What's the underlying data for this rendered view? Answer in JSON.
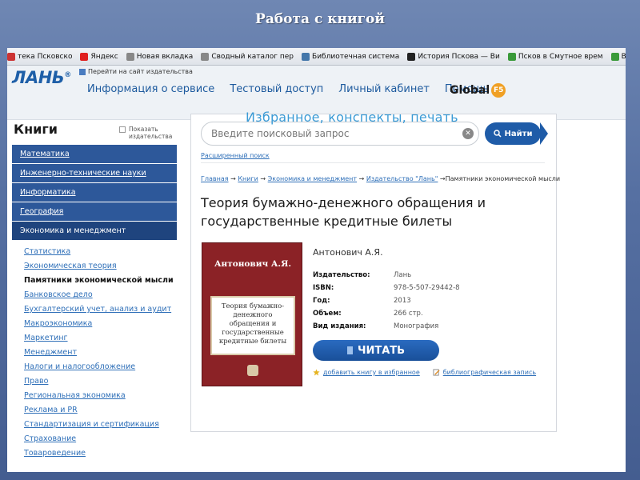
{
  "slide": {
    "title": "Работа с книгой"
  },
  "browser": {
    "bookmarks": [
      {
        "label": "тека Псковско",
        "icon": "library-icon",
        "color": "#cc3333"
      },
      {
        "label": "Яндекс",
        "icon": "yandex-icon",
        "color": "#e02020"
      },
      {
        "label": "Новая вкладка",
        "icon": "page-icon",
        "color": "#888888"
      },
      {
        "label": "Сводный каталог пер",
        "icon": "page-icon",
        "color": "#888888"
      },
      {
        "label": "Библиотечная система",
        "icon": "doc-icon",
        "color": "#4477aa"
      },
      {
        "label": "История Пскова — Ви",
        "icon": "wikipedia-icon",
        "color": "#222222"
      },
      {
        "label": "Псков в Смутное врем",
        "icon": "folder-icon",
        "color": "#3a9a3a"
      },
      {
        "label": "В Пскове стартовала к",
        "icon": "news-icon",
        "color": "#3a9a3a"
      }
    ]
  },
  "site": {
    "logo": "ЛАНЬ",
    "logo_mark": "®",
    "goto_link": "Перейти на сайт издательства",
    "menu": [
      "Информация о сервисе",
      "Тестовый доступ",
      "Личный кабинет",
      "Помощь"
    ],
    "global_label": "Global",
    "global_badge": "F5"
  },
  "sidebar": {
    "title": "Книги",
    "show_publishers": "Показать издательства",
    "categories": [
      "Математика",
      "Инженерно-технические науки",
      "Информатика",
      "География",
      "Экономика и менеджмент"
    ],
    "subcategories": [
      "Статистика",
      "Экономическая теория",
      "Памятники экономической мысли",
      "Банковское дело",
      "Бухгалтерский учет, анализ и аудит",
      "Макроэкономика",
      "Маркетинг",
      "Менеджмент",
      "Налоги и налогообложение",
      "Право",
      "Региональная экономика",
      "Реклама и PR",
      "Стандартизация и сертификация",
      "Страхование",
      "Товароведение"
    ],
    "active_subcategory_index": 2
  },
  "main": {
    "overlay_caption": "Избранное, конспекты, печать",
    "search_placeholder": "Введите поисковый запрос",
    "search_clear": "✕",
    "find_button": "Найти",
    "advanced_search": "Расширенный поиск",
    "breadcrumbs": [
      "Главная",
      "Книги",
      "Экономика и менеджмент",
      "Издательство \"Лань\""
    ],
    "breadcrumb_sep": "→",
    "breadcrumb_current": "Памятники экономической мысли",
    "book": {
      "title": "Теория бумажно-денежного обращения и государственные кредитные билеты",
      "cover_author": "Антонович А.Я.",
      "cover_title": "Теория бумажно-денежного обращения и государственные кредитные билеты",
      "author": "Антонович А.Я.",
      "details": [
        {
          "key": "Издательство:",
          "value": "Лань"
        },
        {
          "key": "ISBN:",
          "value": "978-5-507-29442-8"
        },
        {
          "key": "Год:",
          "value": "2013"
        },
        {
          "key": "Объем:",
          "value": "266 стр."
        },
        {
          "key": "Вид издания:",
          "value": "Монография"
        }
      ],
      "read_button": "ЧИТАТЬ",
      "add_favorite": "добавить книгу в избранное",
      "bibliography": "библиографическая запись"
    }
  }
}
